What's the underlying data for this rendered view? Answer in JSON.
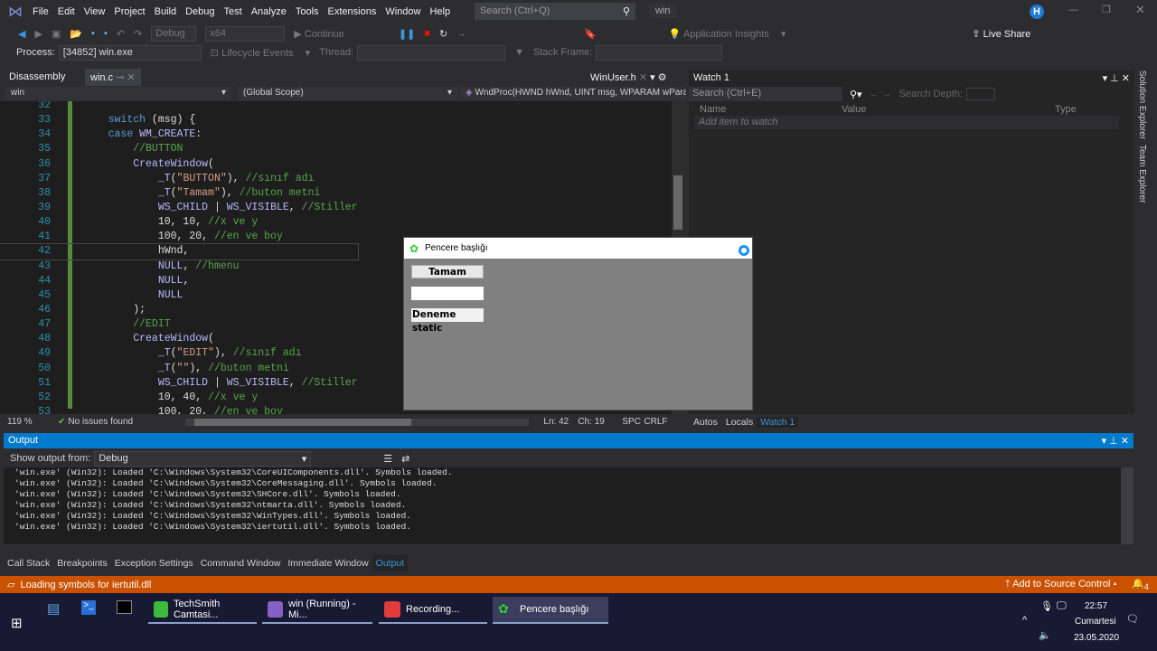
{
  "menubar": {
    "items": [
      "File",
      "Edit",
      "View",
      "Project",
      "Build",
      "Debug",
      "Test",
      "Analyze",
      "Tools",
      "Extensions",
      "Window",
      "Help"
    ],
    "search_placeholder": "Search (Ctrl+Q)",
    "solution_name": "win",
    "avatar_letter": "H"
  },
  "toolbar": {
    "config": "Debug",
    "platform": "x64",
    "continue": "Continue",
    "app_insights": "Application Insights",
    "live_share": "Live Share"
  },
  "toolbar2": {
    "process_label": "Process:",
    "process_value": "[34852] win.exe",
    "lifecycle": "Lifecycle Events",
    "thread_label": "Thread:",
    "stack_frame_label": "Stack Frame:"
  },
  "tabs": {
    "disassembly": "Disassembly",
    "winc": "win.c",
    "winuser": "WinUser.h"
  },
  "nav": {
    "project": "win",
    "scope": "(Global Scope)",
    "function": "WndProc(HWND hWnd, UINT msg, WPARAM wPara"
  },
  "code": [
    {
      "n": "32",
      "t": []
    },
    {
      "n": "33",
      "t": [
        [
          "pl",
          "    "
        ],
        [
          "kw",
          "switch"
        ],
        [
          "pl",
          " (msg) {"
        ]
      ]
    },
    {
      "n": "34",
      "t": [
        [
          "pl",
          "    "
        ],
        [
          "kw",
          "case"
        ],
        [
          "pl",
          " "
        ],
        [
          "mc",
          "WM_CREATE"
        ],
        [
          "pl",
          ":"
        ]
      ]
    },
    {
      "n": "35",
      "t": [
        [
          "pl",
          "        "
        ],
        [
          "cm",
          "//BUTTON"
        ]
      ]
    },
    {
      "n": "36",
      "t": [
        [
          "pl",
          "        "
        ],
        [
          "mc",
          "CreateWindow"
        ],
        [
          "pl",
          "("
        ]
      ]
    },
    {
      "n": "37",
      "t": [
        [
          "pl",
          "            "
        ],
        [
          "mc",
          "_T"
        ],
        [
          "pl",
          "("
        ],
        [
          "st",
          "\"BUTTON\""
        ],
        [
          "pl",
          "), "
        ],
        [
          "cm",
          "//sınıf adı"
        ]
      ]
    },
    {
      "n": "38",
      "t": [
        [
          "pl",
          "            "
        ],
        [
          "mc",
          "_T"
        ],
        [
          "pl",
          "("
        ],
        [
          "st",
          "\"Tamam\""
        ],
        [
          "pl",
          "), "
        ],
        [
          "cm",
          "//buton metni"
        ]
      ]
    },
    {
      "n": "39",
      "t": [
        [
          "pl",
          "            "
        ],
        [
          "mc",
          "WS_CHILD"
        ],
        [
          "pl",
          " | "
        ],
        [
          "mc",
          "WS_VISIBLE"
        ],
        [
          "pl",
          ", "
        ],
        [
          "cm",
          "//Stiller"
        ]
      ]
    },
    {
      "n": "40",
      "t": [
        [
          "pl",
          "            10, 10, "
        ],
        [
          "cm",
          "//x ve y"
        ]
      ]
    },
    {
      "n": "41",
      "t": [
        [
          "pl",
          "            100, 20, "
        ],
        [
          "cm",
          "//en ve boy"
        ]
      ]
    },
    {
      "n": "42",
      "t": [
        [
          "pl",
          "            hWnd,"
        ]
      ]
    },
    {
      "n": "43",
      "t": [
        [
          "pl",
          "            "
        ],
        [
          "mc",
          "NULL"
        ],
        [
          "pl",
          ", "
        ],
        [
          "cm",
          "//hmenu"
        ]
      ]
    },
    {
      "n": "44",
      "t": [
        [
          "pl",
          "            "
        ],
        [
          "mc",
          "NULL"
        ],
        [
          "pl",
          ","
        ]
      ]
    },
    {
      "n": "45",
      "t": [
        [
          "pl",
          "            "
        ],
        [
          "mc",
          "NULL"
        ]
      ]
    },
    {
      "n": "46",
      "t": [
        [
          "pl",
          "        );"
        ]
      ]
    },
    {
      "n": "47",
      "t": [
        [
          "pl",
          "        "
        ],
        [
          "cm",
          "//EDIT"
        ]
      ]
    },
    {
      "n": "48",
      "t": [
        [
          "pl",
          "        "
        ],
        [
          "mc",
          "CreateWindow"
        ],
        [
          "pl",
          "("
        ]
      ]
    },
    {
      "n": "49",
      "t": [
        [
          "pl",
          "            "
        ],
        [
          "mc",
          "_T"
        ],
        [
          "pl",
          "("
        ],
        [
          "st",
          "\"EDIT\""
        ],
        [
          "pl",
          "), "
        ],
        [
          "cm",
          "//sınıf adı"
        ]
      ]
    },
    {
      "n": "50",
      "t": [
        [
          "pl",
          "            "
        ],
        [
          "mc",
          "_T"
        ],
        [
          "pl",
          "("
        ],
        [
          "st",
          "\"\""
        ],
        [
          "pl",
          "), "
        ],
        [
          "cm",
          "//buton metni"
        ]
      ]
    },
    {
      "n": "51",
      "t": [
        [
          "pl",
          "            "
        ],
        [
          "mc",
          "WS_CHILD"
        ],
        [
          "pl",
          " | "
        ],
        [
          "mc",
          "WS_VISIBLE"
        ],
        [
          "pl",
          ", "
        ],
        [
          "cm",
          "//Stiller"
        ]
      ]
    },
    {
      "n": "52",
      "t": [
        [
          "pl",
          "            10, 40, "
        ],
        [
          "cm",
          "//x ve y"
        ]
      ]
    },
    {
      "n": "53",
      "t": [
        [
          "pl",
          "            100, 20, "
        ],
        [
          "cm",
          "//en ve boy"
        ]
      ]
    }
  ],
  "editor_status": {
    "zoom": "119 %",
    "issues": "No issues found",
    "line": "Ln: 42",
    "col": "Ch: 19",
    "spc": "SPC",
    "crlf": "CRLF"
  },
  "watch": {
    "title": "Watch 1",
    "search_placeholder": "Search (Ctrl+E)",
    "search_depth": "Search Depth:",
    "col_name": "Name",
    "col_value": "Value",
    "col_type": "Type",
    "add_item": "Add item to watch",
    "tabs": [
      "Autos",
      "Locals",
      "Watch 1"
    ]
  },
  "side_tabs": [
    "Solution Explorer",
    "Team Explorer"
  ],
  "dialog": {
    "title": "Pencere başlığı",
    "button": "Tamam",
    "edit_value": "",
    "static": "Deneme static"
  },
  "output": {
    "title": "Output",
    "show_from_label": "Show output from:",
    "source": "Debug",
    "lines": [
      "'win.exe' (Win32): Loaded 'C:\\Windows\\System32\\CoreUIComponents.dll'. Symbols loaded.",
      "'win.exe' (Win32): Loaded 'C:\\Windows\\System32\\CoreMessaging.dll'. Symbols loaded.",
      "'win.exe' (Win32): Loaded 'C:\\Windows\\System32\\SHCore.dll'. Symbols loaded.",
      "'win.exe' (Win32): Loaded 'C:\\Windows\\System32\\ntmarta.dll'. Symbols loaded.",
      "'win.exe' (Win32): Loaded 'C:\\Windows\\System32\\WinTypes.dll'. Symbols loaded.",
      "'win.exe' (Win32): Loaded 'C:\\Windows\\System32\\iertutil.dll'. Symbols loaded."
    ]
  },
  "bottom_tabs": [
    "Call Stack",
    "Breakpoints",
    "Exception Settings",
    "Command Window",
    "Immediate Window",
    "Output"
  ],
  "statusbar": {
    "message": "Loading symbols for iertutil.dll",
    "source_control": "Add to Source Control",
    "notifications": "4"
  },
  "taskbar": {
    "apps": [
      "TechSmith Camtasi...",
      "win (Running) - Mi...",
      "Recording...",
      "Pencere başlığı"
    ],
    "time": "22:57",
    "day": "Cumartesi",
    "date": "23.05.2020"
  },
  "colors": {
    "accent": "#007acc",
    "status": "#ca5100",
    "taskbar": "#181a33"
  }
}
